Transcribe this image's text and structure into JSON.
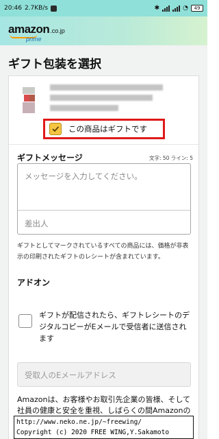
{
  "status_bar": {
    "time": "20:46",
    "speed": "2.7KB/s",
    "battery": "49"
  },
  "header": {
    "logo_brand": "amazon",
    "logo_tld": ".co.jp",
    "logo_prime": "prime"
  },
  "page": {
    "title": "ギフト包装を選択"
  },
  "product": {
    "gift_checkbox_label": "この商品はギフトです",
    "gift_checked": true
  },
  "gift_message": {
    "title": "ギフトメッセージ",
    "char_info": "文字: 50 ライン: 5",
    "message_placeholder": "メッセージを入力してください。",
    "sender_placeholder": "差出人",
    "note": "ギフトとしてマークされているすべての商品には、価格が非表示の印刷されたギフトのレシートが含まれています。"
  },
  "addon": {
    "title": "アドオン",
    "checkbox_label": "ギフトが配信されたら、ギフトレシートのデジタルコピーがEメールで受信者に送信されます",
    "email_placeholder": "受取人のEメールアドレス"
  },
  "notice": "Amazonは、お客様やお取引先企業の皆様、そして社員の健康と安全を重視、しばらくの間Amazonのギフトラッピングサービスを停止いたします。ギフトラッピングサービスの停止中、ギフトメ",
  "watermark": {
    "line1": "http://www.neko.ne.jp/~freewing/",
    "line2": "Copyright (c) 2020 FREE WING,Y.Sakamoto"
  },
  "colors": {
    "header_accent": "#a6e6e3",
    "checkbox_checked": "#f5c542",
    "highlight_border": "#e01919",
    "page_background": "#f1f2f2"
  }
}
